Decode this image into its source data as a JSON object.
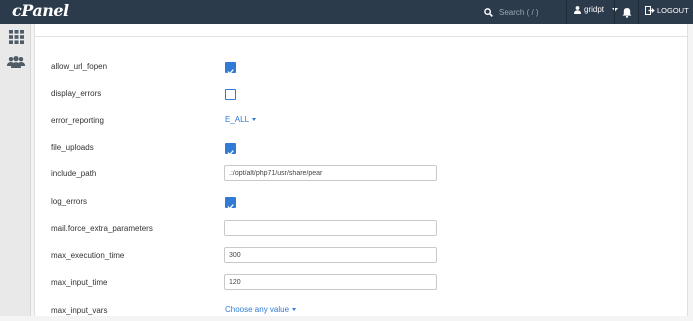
{
  "app": {
    "logo": "cPanel"
  },
  "header": {
    "search_placeholder": "Search ( / )",
    "username": "gridpt",
    "logout_label": "LOGOUT"
  },
  "settings": [
    {
      "name": "allow_url_fopen",
      "type": "checkbox",
      "checked": true
    },
    {
      "name": "display_errors",
      "type": "checkbox",
      "checked": false
    },
    {
      "name": "error_reporting",
      "type": "select",
      "value": "E_ALL"
    },
    {
      "name": "file_uploads",
      "type": "checkbox",
      "checked": true
    },
    {
      "name": "include_path",
      "type": "text",
      "value": ".:/opt/alt/php71/usr/share/pear"
    },
    {
      "name": "log_errors",
      "type": "checkbox",
      "checked": true
    },
    {
      "name": "mail.force_extra_parameters",
      "type": "text",
      "value": ""
    },
    {
      "name": "max_execution_time",
      "type": "text",
      "value": "300"
    },
    {
      "name": "max_input_time",
      "type": "text",
      "value": "120"
    },
    {
      "name": "max_input_vars",
      "type": "select",
      "value": "Choose any value"
    }
  ]
}
